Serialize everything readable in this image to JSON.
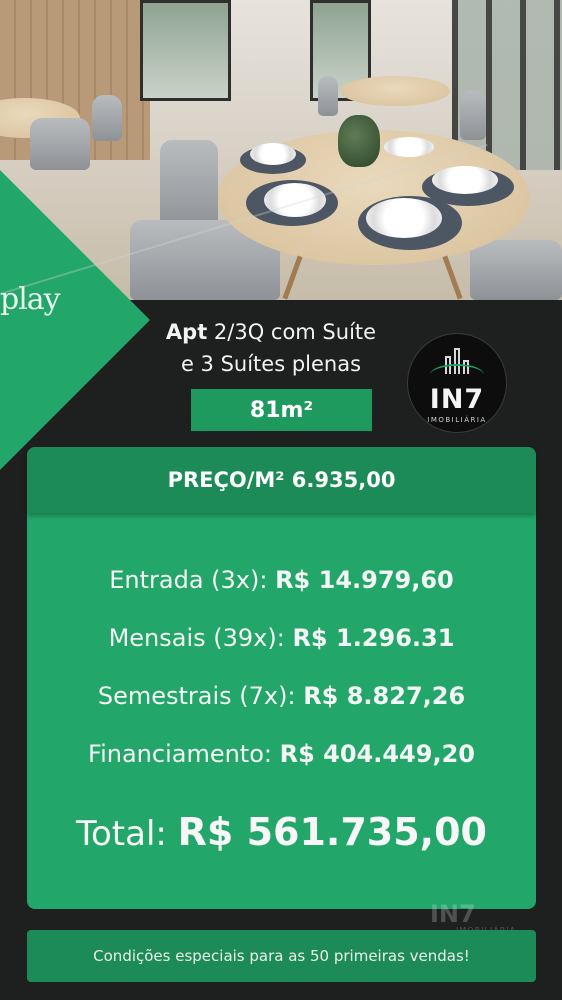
{
  "brand": {
    "play_text": "play"
  },
  "headline": {
    "line1_bold": "Apt",
    "line1_rest": " 2/3Q com Suíte",
    "line2": "e 3 Suítes plenas"
  },
  "area_badge": "81m²",
  "logo": {
    "name": "IN7",
    "subtitle": "IMOBILIÁRIA"
  },
  "price_per_m2": "PREÇO/M² 6.935,00",
  "payments": [
    {
      "label": "Entrada (3x): ",
      "value": "R$ 14.979,60"
    },
    {
      "label": "Mensais (39x): ",
      "value": "R$ 1.296.31"
    },
    {
      "label": "Semestrais (7x): ",
      "value": "R$ 8.827,26"
    },
    {
      "label": "Financiamento: ",
      "value": "R$ 404.449,20"
    }
  ],
  "total": {
    "label": "Total: ",
    "value": "R$ 561.735,00"
  },
  "watermark": {
    "name": "IN7",
    "subtitle": "IMOBILIÁRIA"
  },
  "footer_note": "Condições especiais para as 50 primeiras vendas!",
  "colors": {
    "green_primary": "#23a66a",
    "green_dark": "#1c8b57",
    "background_dark": "#1e1f1f"
  }
}
